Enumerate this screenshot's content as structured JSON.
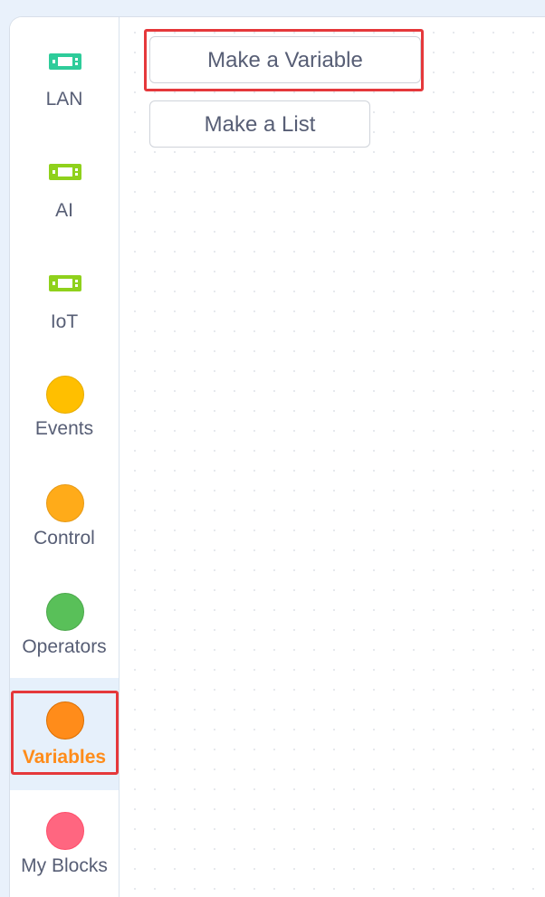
{
  "sidebar": {
    "categories": [
      {
        "label": "LAN",
        "icon": "extension-chip-icon",
        "color": "#2ecc9a"
      },
      {
        "label": "AI",
        "icon": "extension-chip-icon",
        "color": "#8fd11c"
      },
      {
        "label": "IoT",
        "icon": "extension-chip-icon",
        "color": "#8fd11c"
      },
      {
        "label": "Events",
        "icon": "circle",
        "color": "#ffbf00"
      },
      {
        "label": "Control",
        "icon": "circle",
        "color": "#ffab19"
      },
      {
        "label": "Operators",
        "icon": "circle",
        "color": "#59c059"
      },
      {
        "label": "Variables",
        "icon": "circle",
        "color": "#ff8c1a",
        "selected": true
      },
      {
        "label": "My Blocks",
        "icon": "circle",
        "color": "#ff6680"
      }
    ]
  },
  "workspace": {
    "make_variable_label": "Make a Variable",
    "make_list_label": "Make a List"
  },
  "colors": {
    "highlight": "#e5383b",
    "selected_text": "#ff8c1a",
    "selected_bg": "#e6f0fb"
  }
}
